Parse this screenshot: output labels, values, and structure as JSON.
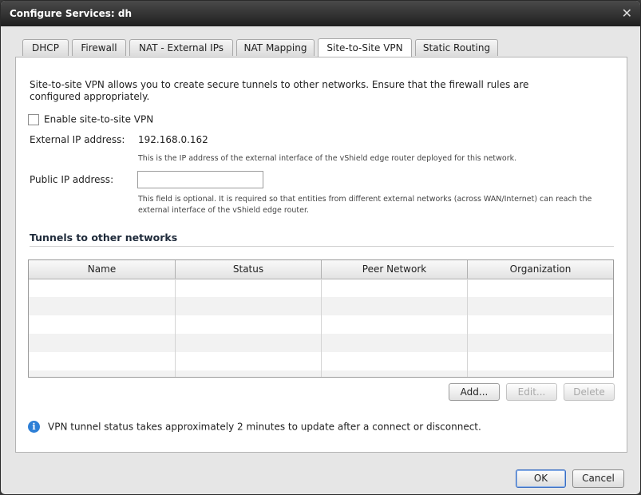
{
  "window": {
    "title": "Configure Services: dh",
    "close_glyph": "✕"
  },
  "tabs": [
    {
      "label": "DHCP"
    },
    {
      "label": "Firewall"
    },
    {
      "label": "NAT - External IPs"
    },
    {
      "label": "NAT Mapping"
    },
    {
      "label": "Site-to-Site VPN",
      "active": true
    },
    {
      "label": "Static Routing"
    }
  ],
  "content": {
    "intro": "Site-to-site VPN allows you to create secure tunnels to other networks. Ensure that the firewall rules are configured appropriately.",
    "enable_label": "Enable site-to-site VPN",
    "enable_checked": false,
    "external_ip_label": "External IP address:",
    "external_ip_value": "192.168.0.162",
    "external_ip_hint": "This is the IP address of the external interface of the vShield edge router deployed for this network.",
    "public_ip_label": "Public IP address:",
    "public_ip_value": "",
    "public_ip_hint": "This field is optional. It is required so that entities from different external networks (across WAN/Internet) can reach the external interface of the vShield edge router."
  },
  "tunnels": {
    "section_title": "Tunnels to other networks",
    "columns": [
      "Name",
      "Status",
      "Peer Network",
      "Organization"
    ],
    "rows": []
  },
  "actions": {
    "add": "Add...",
    "edit": "Edit...",
    "delete": "Delete"
  },
  "info": {
    "icon": "info-icon",
    "text": "VPN tunnel status takes approximately 2 minutes to update after a connect or disconnect."
  },
  "footer": {
    "ok": "OK",
    "cancel": "Cancel"
  }
}
